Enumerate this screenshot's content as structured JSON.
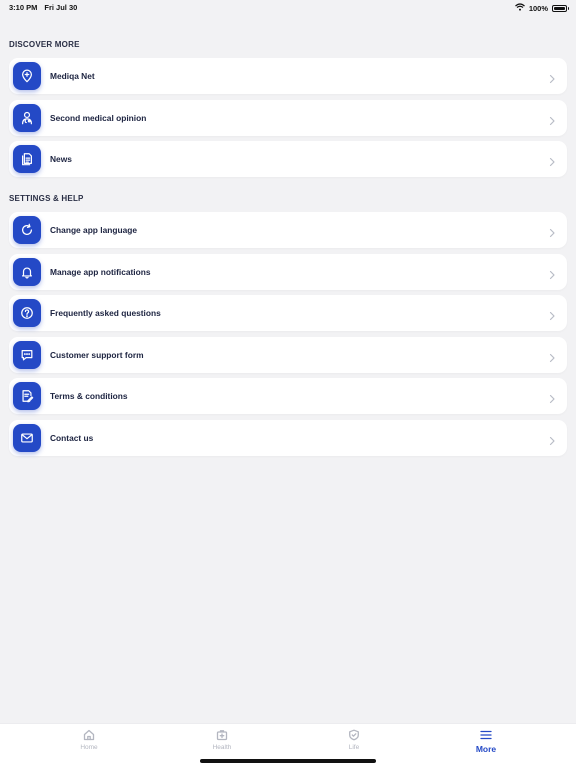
{
  "status_bar": {
    "time": "3:10 PM",
    "date": "Fri Jul 30",
    "battery": "100%",
    "battery_level": 1.0
  },
  "colors": {
    "accent": "#2449c6",
    "background": "#f2f2f4",
    "card": "#ffffff",
    "inactive": "#b3b6c0"
  },
  "discover": {
    "title": "DISCOVER MORE",
    "items": [
      {
        "label": "Mediqa Net",
        "icon": "location-pin-plus-icon"
      },
      {
        "label": "Second medical opinion",
        "icon": "doctor-icon"
      },
      {
        "label": "News",
        "icon": "document-icon"
      }
    ]
  },
  "settings": {
    "title": "SETTINGS & HELP",
    "items": [
      {
        "label": "Change app language",
        "icon": "refresh-icon"
      },
      {
        "label": "Manage app notifications",
        "icon": "bell-icon"
      },
      {
        "label": "Frequently asked questions",
        "icon": "question-circle-icon"
      },
      {
        "label": "Customer support form",
        "icon": "chat-bubble-icon"
      },
      {
        "label": "Terms & conditions",
        "icon": "document-pen-icon"
      },
      {
        "label": "Contact us",
        "icon": "mail-icon"
      }
    ]
  },
  "tab_bar": {
    "tabs": [
      {
        "label": "Home",
        "icon": "home-icon"
      },
      {
        "label": "Health",
        "icon": "medical-kit-icon"
      },
      {
        "label": "Life",
        "icon": "shield-icon"
      },
      {
        "label": "More",
        "icon": "menu-icon"
      }
    ],
    "active": "More"
  }
}
